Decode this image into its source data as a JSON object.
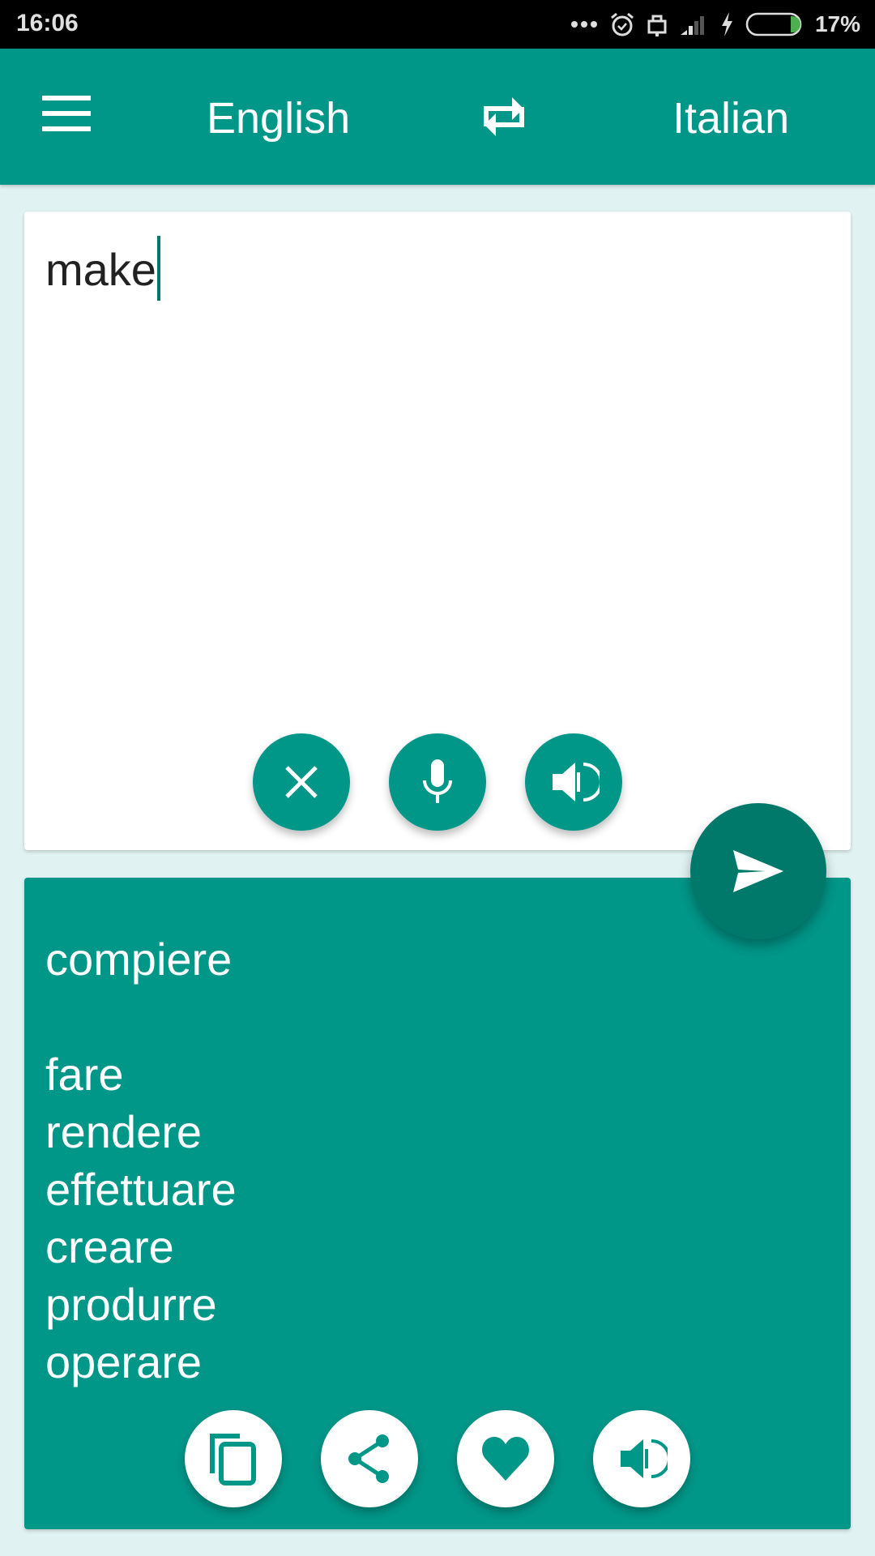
{
  "status_bar": {
    "time": "16:06",
    "battery_percent": "17%",
    "battery_level": 0.17,
    "icons": [
      "more-dots-icon",
      "alarm-icon",
      "lock-icon",
      "signal-icon",
      "charging-icon",
      "battery-icon"
    ]
  },
  "app_bar": {
    "menu_icon": "hamburger-menu-icon",
    "source_language": "English",
    "swap_icon": "swap-languages-icon",
    "target_language": "Italian"
  },
  "input": {
    "text": "make",
    "buttons": [
      {
        "name": "clear",
        "icon": "close-icon"
      },
      {
        "name": "voice-input",
        "icon": "microphone-icon"
      },
      {
        "name": "speak-source",
        "icon": "speaker-icon"
      }
    ]
  },
  "translate_button": {
    "icon": "send-icon"
  },
  "output": {
    "lines": [
      "compiere",
      "",
      "fare",
      "rendere",
      "effettuare",
      "creare",
      "produrre",
      "operare"
    ],
    "buttons": [
      {
        "name": "copy",
        "icon": "copy-icon"
      },
      {
        "name": "share",
        "icon": "share-icon"
      },
      {
        "name": "favorite",
        "icon": "heart-icon"
      },
      {
        "name": "speak-translation",
        "icon": "speaker-icon"
      }
    ]
  },
  "colors": {
    "primary": "#009688",
    "primary_dark": "#00796b",
    "background": "#e0f2f1",
    "battery_green": "#4caf50"
  }
}
